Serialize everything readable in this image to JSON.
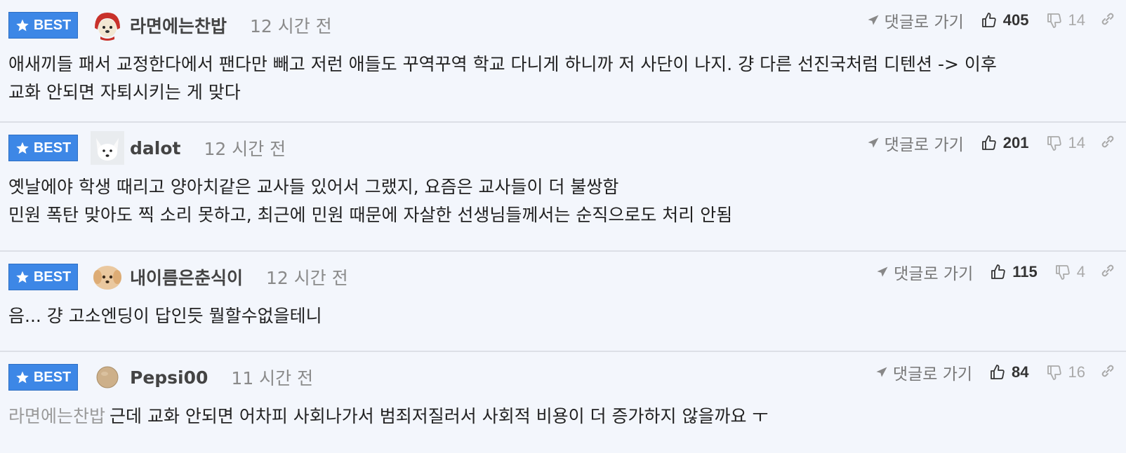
{
  "comments": [
    {
      "badge": "BEST",
      "username": "라면에는찬밥",
      "time": "12 시간 전",
      "goto_label": "댓글로 가기",
      "likes": "405",
      "dislikes": "14",
      "avatar": "puppy-red-hood",
      "lines": [
        "애새끼들 패서 교정한다에서 팬다만 빼고 저런 애들도 꾸역꾸역 학교 다니게 하니까 저 사단이 나지. 걍 다른 선진국처럼 디텐션 -> 이후",
        "교화 안되면 자퇴시키는 게 맞다"
      ]
    },
    {
      "badge": "BEST",
      "username": "dalot",
      "time": "12 시간 전",
      "goto_label": "댓글로 가기",
      "likes": "201",
      "dislikes": "14",
      "avatar": "white-fox",
      "lines": [
        "옛날에야 학생 때리고 양아치같은 교사들 있어서 그랬지, 요즘은 교사들이 더 불쌍함",
        "민원 폭탄 맞아도 찍 소리 못하고, 최근에 민원 때문에 자살한 선생님들께서는 순직으로도 처리 안됨"
      ]
    },
    {
      "badge": "BEST",
      "username": "내이름은춘식이",
      "time": "12 시간 전",
      "goto_label": "댓글로 가기",
      "likes": "115",
      "dislikes": "4",
      "avatar": "blurred-puppy",
      "lines": [
        "음... 걍 고소엔딩이 답인듯 뭘할수없을테니"
      ]
    },
    {
      "badge": "BEST",
      "username": "Pepsi00",
      "time": "11 시간 전",
      "goto_label": "댓글로 가기",
      "likes": "84",
      "dislikes": "16",
      "avatar": "tan-circle",
      "mention": "라면에는찬밥",
      "lines": [
        "근데 교화 안되면 어차피 사회나가서 범죄저질러서 사회적 비용이 더 증가하지 않을까요 ㅜ"
      ]
    }
  ],
  "colors": {
    "badge_bg": "#3d87e6",
    "page_bg": "#f3f6fc",
    "divider": "#dcdfe6"
  }
}
